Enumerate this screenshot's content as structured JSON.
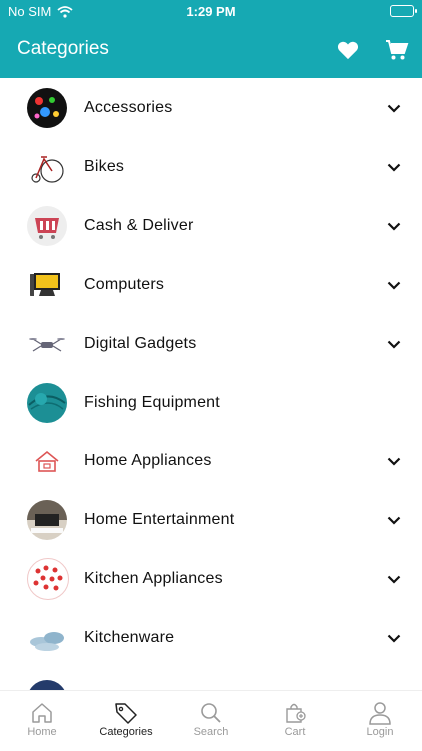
{
  "status_bar": {
    "carrier": "No SIM",
    "time": "1:29 PM"
  },
  "header": {
    "title": "Categories",
    "icons": [
      "heart-icon",
      "cart-icon"
    ]
  },
  "categories": [
    {
      "label": "Accessories",
      "has_submenu": true
    },
    {
      "label": "Bikes",
      "has_submenu": true
    },
    {
      "label": "Cash & Deliver",
      "has_submenu": true
    },
    {
      "label": "Computers",
      "has_submenu": true
    },
    {
      "label": "Digital Gadgets",
      "has_submenu": true
    },
    {
      "label": "Fishing Equipment",
      "has_submenu": false
    },
    {
      "label": "Home Appliances",
      "has_submenu": true
    },
    {
      "label": "Home Entertainment",
      "has_submenu": true
    },
    {
      "label": "Kitchen Appliances",
      "has_submenu": true
    },
    {
      "label": "Kitchenware",
      "has_submenu": true
    }
  ],
  "bottom_nav": [
    {
      "label": "Home",
      "icon": "home-icon",
      "active": false
    },
    {
      "label": "Categories",
      "icon": "tag-icon",
      "active": true
    },
    {
      "label": "Search",
      "icon": "search-icon",
      "active": false
    },
    {
      "label": "Cart",
      "icon": "bag-icon",
      "active": false
    },
    {
      "label": "Login",
      "icon": "user-icon",
      "active": false
    }
  ],
  "colors": {
    "header": "#16a9b3",
    "inactive_tab": "#9a9a9a",
    "active_tab": "#222222"
  }
}
